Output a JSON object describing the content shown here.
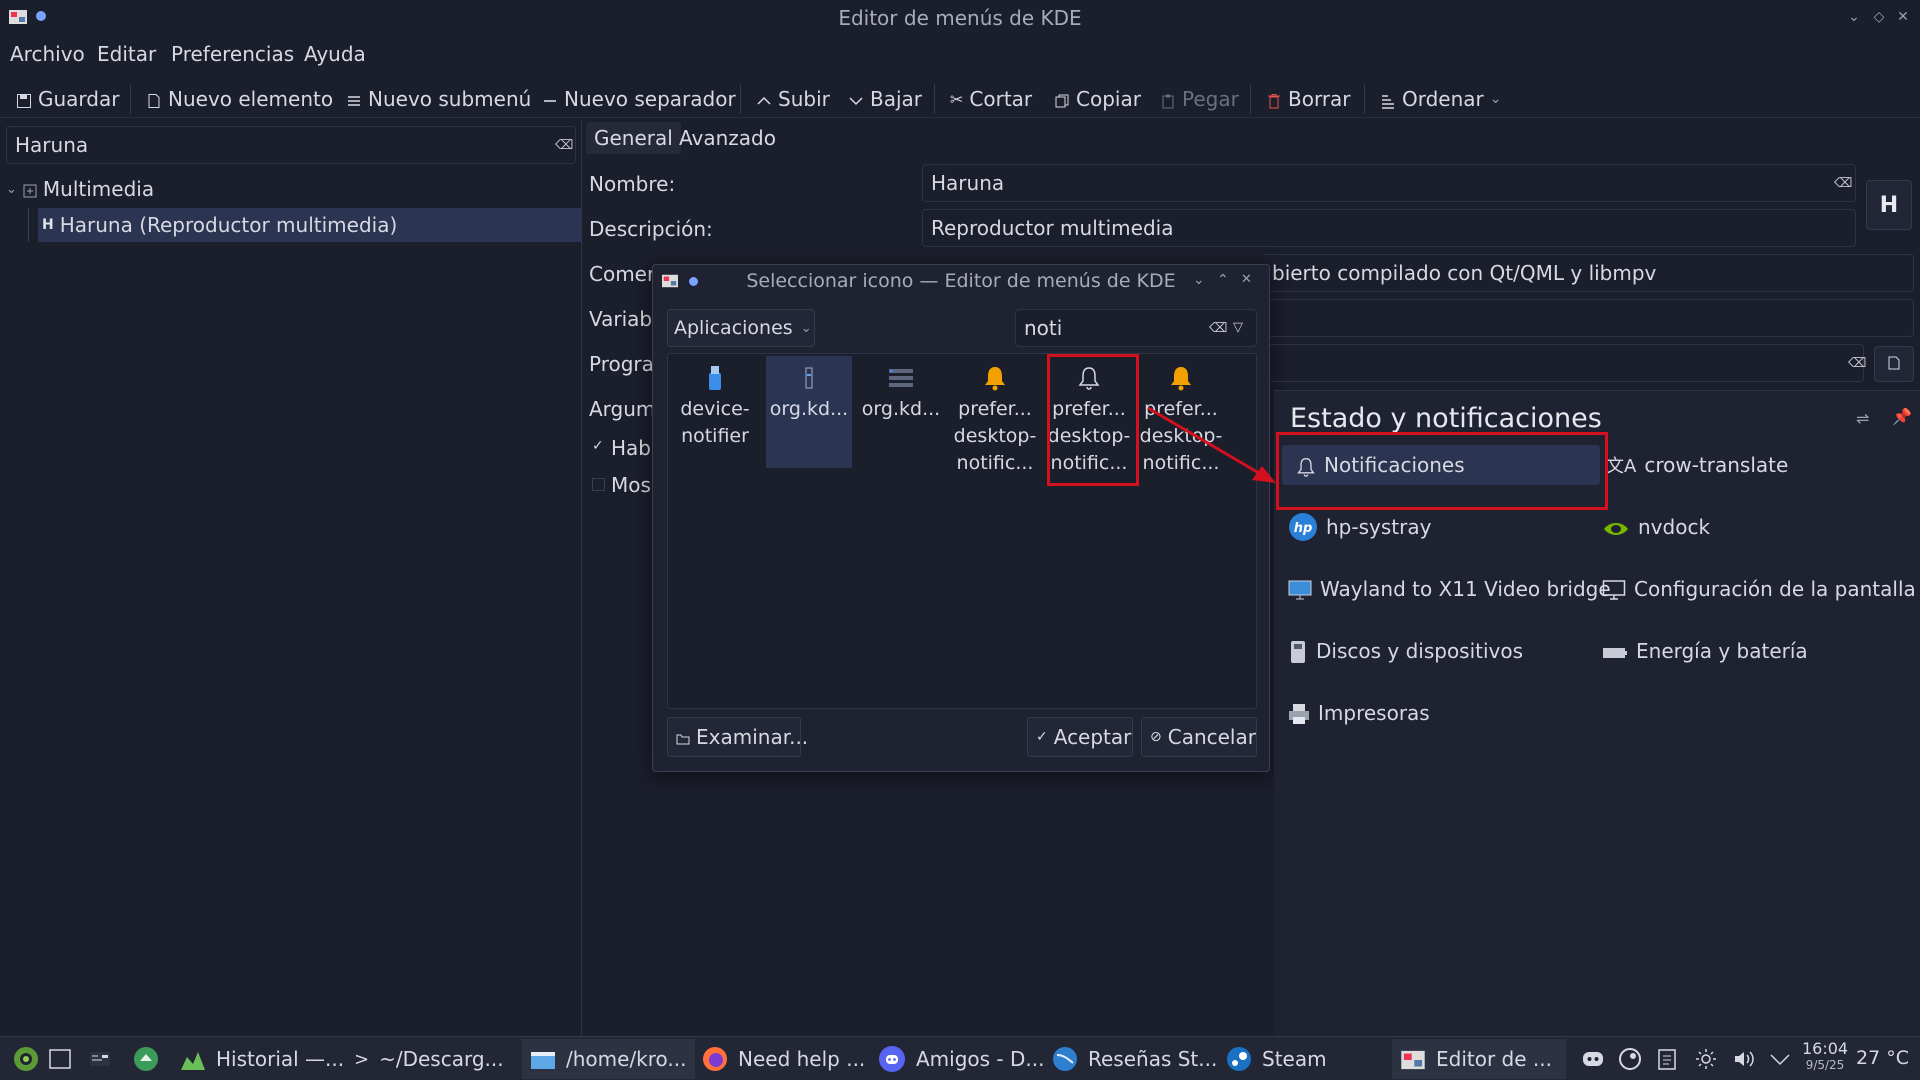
{
  "window": {
    "title": "Editor de menús de KDE"
  },
  "menubar": [
    "Archivo",
    "Editar",
    "Preferencias",
    "Ayuda"
  ],
  "toolbar": {
    "save": "Guardar",
    "new_item": "Nuevo elemento",
    "new_submenu": "Nuevo submenú",
    "new_separator": "Nuevo separador",
    "move_up": "Subir",
    "move_down": "Bajar",
    "cut": "Cortar",
    "copy": "Copiar",
    "paste": "Pegar",
    "delete": "Borrar",
    "sort": "Ordenar"
  },
  "search": {
    "value": "Haruna"
  },
  "tree": {
    "category": "Multimedia",
    "item": "Haruna (Reproductor multimedia)"
  },
  "tabs": [
    "General",
    "Avanzado"
  ],
  "form": {
    "name_label": "Nombre:",
    "name_value": "Haruna",
    "description_label": "Descripción:",
    "description_value": "Reproductor multimedia",
    "comment_label": "Comer",
    "comment_value": "bierto compilado con Qt/QML y libmpv",
    "env_label": "Variabl",
    "program_label": "Progra",
    "args_label": "Argum",
    "enabled_label": "Hab",
    "show_label": "Mos"
  },
  "dialog": {
    "title": "Seleccionar icono — Editor de menús de KDE",
    "category": "Aplicaciones",
    "filter": "noti",
    "icons": [
      {
        "label": "device-\nnotifier",
        "icon": "usb-drive-icon"
      },
      {
        "label": "org.kd...",
        "icon": "panel-icon"
      },
      {
        "label": "org.kd...",
        "icon": "list-icon"
      },
      {
        "label": "prefer...\ndesktop-\nnotific...",
        "icon": "bell-yellow-icon"
      },
      {
        "label": "prefer...\ndesktop-\nnotific...",
        "icon": "bell-outline-icon"
      },
      {
        "label": "prefer...\ndesktop-\nnotific...",
        "icon": "bell-yellow-icon"
      }
    ],
    "browse": "Examinar...",
    "ok": "Aceptar",
    "cancel": "Cancelar"
  },
  "notifications_panel": {
    "title": "Estado y notificaciones",
    "items": [
      {
        "label": "Notificaciones",
        "icon": "bell-icon"
      },
      {
        "label": "crow-translate",
        "icon": "translate-icon"
      },
      {
        "label": "hp-systray",
        "icon": "hp-logo-icon"
      },
      {
        "label": "nvdock",
        "icon": "nvidia-icon"
      },
      {
        "label": "Wayland to X11 Video bridge",
        "icon": "monitor-icon"
      },
      {
        "label": "Configuración de la pantalla",
        "icon": "display-settings-icon"
      },
      {
        "label": "Discos y dispositivos",
        "icon": "disk-icon"
      },
      {
        "label": "Energía y batería",
        "icon": "battery-icon"
      },
      {
        "label": "Impresoras",
        "icon": "printer-icon"
      }
    ]
  },
  "taskbar": {
    "tasks": [
      {
        "label": "Historial —...",
        "icon": "chart-icon"
      },
      {
        "label": "~/Descarg...",
        "icon": "terminal-icon"
      },
      {
        "label": "/home/kro...",
        "icon": "folder-icon"
      },
      {
        "label": "Need help ...",
        "icon": "firefox-icon"
      },
      {
        "label": "Amigos - D...",
        "icon": "discord-icon"
      },
      {
        "label": "Reseñas St...",
        "icon": "browser-icon"
      },
      {
        "label": "Steam",
        "icon": "steam-icon"
      },
      {
        "label": "Editor de ...",
        "icon": "kmenuedit-icon"
      }
    ],
    "clock_time": "16:04",
    "clock_date": "9/5/25",
    "temperature": "27 °C"
  },
  "colors": {
    "background": "#1b1e2b",
    "highlight_red": "#d40f1e",
    "selection": "#2b3450",
    "bell_yellow": "#f2a100"
  }
}
